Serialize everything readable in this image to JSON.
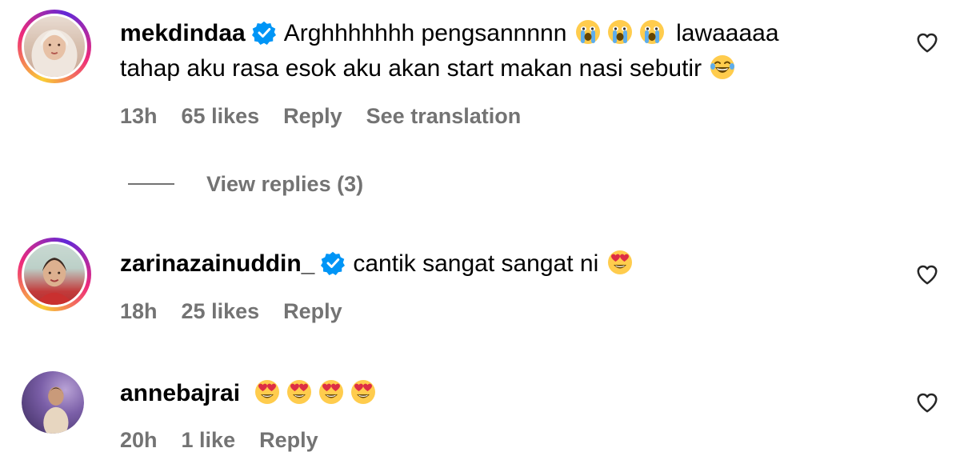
{
  "comments": [
    {
      "username": "mekdindaa",
      "verified": true,
      "text_part1": "Arghhhhhhh pengsannnnn",
      "text_part2": "lawaaaaa",
      "text_line2": "tahap aku rasa esok aku akan start makan nasi sebutir",
      "emojis": [
        "crying-face-emoji",
        "crying-face-emoji",
        "crying-face-emoji",
        "laughing-tears-emoji"
      ],
      "time": "13h",
      "likes": "65 likes",
      "reply": "Reply",
      "translate": "See translation",
      "view_replies": "View replies (3)"
    },
    {
      "username": "zarinazainuddin_",
      "verified": true,
      "text": "cantik sangat sangat ni",
      "emojis": [
        "heart-eyes-emoji"
      ],
      "time": "18h",
      "likes": "25 likes",
      "reply": "Reply"
    },
    {
      "username": "annebajrai",
      "verified": false,
      "text": "",
      "emojis": [
        "heart-eyes-emoji",
        "heart-eyes-emoji",
        "heart-eyes-emoji",
        "heart-eyes-emoji"
      ],
      "time": "20h",
      "likes": "1 like",
      "reply": "Reply"
    }
  ],
  "colors": {
    "meta_gray": "#737373",
    "verified_blue": "#0095f6",
    "text": "#000000"
  }
}
